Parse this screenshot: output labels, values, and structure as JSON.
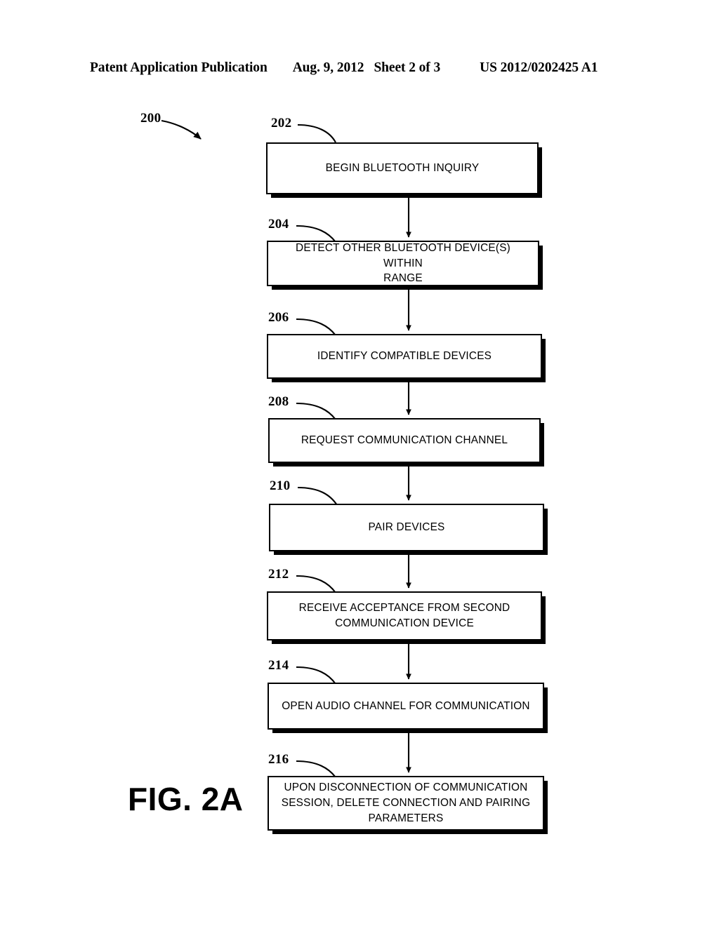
{
  "header": {
    "publication": "Patent Application Publication",
    "date": "Aug. 9, 2012",
    "sheet": "Sheet 2 of 3",
    "patent_number": "US 2012/0202425 A1"
  },
  "figure": {
    "caption": "FIG. 2A",
    "diagram_ref": "200",
    "ref_label_200": "200"
  },
  "flowchart": {
    "type": "flowchart",
    "orientation": "vertical",
    "nodes": [
      {
        "ref": "202",
        "text": "BEGIN BLUETOOTH INQUIRY"
      },
      {
        "ref": "204",
        "text": "DETECT OTHER BLUETOOTH DEVICE(S) WITHIN\nRANGE"
      },
      {
        "ref": "206",
        "text": "IDENTIFY COMPATIBLE DEVICES"
      },
      {
        "ref": "208",
        "text": "REQUEST COMMUNICATION CHANNEL"
      },
      {
        "ref": "210",
        "text": "PAIR DEVICES"
      },
      {
        "ref": "212",
        "text": "RECEIVE ACCEPTANCE FROM SECOND\nCOMMUNICATION DEVICE"
      },
      {
        "ref": "214",
        "text": "OPEN AUDIO CHANNEL FOR COMMUNICATION"
      },
      {
        "ref": "216",
        "text": "UPON DISCONNECTION OF COMMUNICATION\nSESSION, DELETE CONNECTION AND PAIRING\nPARAMETERS"
      }
    ],
    "edges": [
      {
        "from": "202",
        "to": "204"
      },
      {
        "from": "204",
        "to": "206"
      },
      {
        "from": "206",
        "to": "208"
      },
      {
        "from": "208",
        "to": "210"
      },
      {
        "from": "210",
        "to": "212"
      },
      {
        "from": "212",
        "to": "214"
      },
      {
        "from": "214",
        "to": "216"
      }
    ]
  },
  "colors": {
    "ink": "#000000",
    "page": "#ffffff"
  }
}
